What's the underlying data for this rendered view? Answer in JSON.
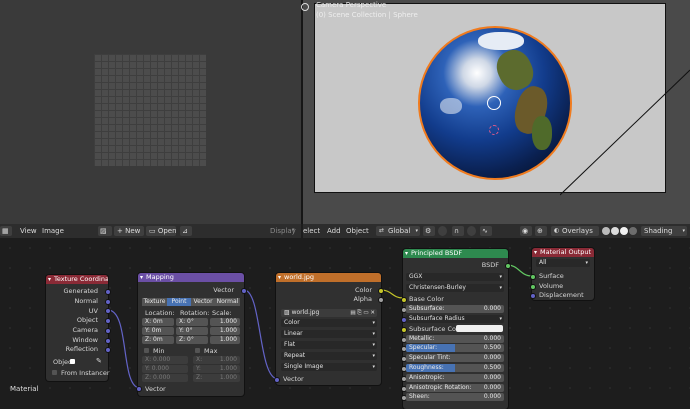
{
  "viewport": {
    "title": "Camera Perspective",
    "subtitle": "(0) Scene Collection | Sphere",
    "header": {
      "menu_select": "elect",
      "menu_add": "Add",
      "menu_object": "Object",
      "transform_orientation": "Global",
      "overlays": "Overlays",
      "shading": "Shading"
    }
  },
  "image_editor": {
    "header": {
      "view": "View",
      "image": "Image",
      "new": "New",
      "open": "Open",
      "display": "Display"
    }
  },
  "node_editor": {
    "material_label": "Material",
    "tex_coord": {
      "title": "Texture Coordina.",
      "outputs": [
        "Generated",
        "Normal",
        "UV",
        "Object",
        "Camera",
        "Window",
        "Reflection"
      ],
      "object_label": "Objec",
      "from_instancer": "From Instancer"
    },
    "mapping": {
      "title": "Mapping",
      "output": "Vector",
      "tabs": [
        "Texture",
        "Point",
        "Vector",
        "Normal"
      ],
      "active_tab": "Point",
      "location_label": "Location:",
      "rotation_label": "Rotation:",
      "scale_label": "Scale:",
      "location": [
        "X: 0m",
        "Y: 0m",
        "Z: 0m"
      ],
      "rotation": [
        "X:  0°",
        "Y:  0°",
        "Z:  0°"
      ],
      "scale": [
        "1.000",
        "1.000",
        "1.000"
      ],
      "min_label": "Min",
      "max_label": "Max",
      "min": [
        "X:   0.000",
        "Y:   0.000",
        "Z:   0.000"
      ],
      "max": [
        "1.000",
        "1.000",
        "1.000"
      ],
      "max_axes": [
        "X:",
        "Y:",
        "Z:"
      ],
      "input": "Vector"
    },
    "image_tex": {
      "title": "world.jpg",
      "outputs": [
        "Color",
        "Alpha"
      ],
      "image_name": "world.jpg",
      "dropdowns": [
        "Color",
        "Linear",
        "Flat",
        "Repeat",
        "Single Image"
      ],
      "input": "Vector"
    },
    "bsdf": {
      "title": "Principled BSDF",
      "output": "BSDF",
      "distribution": "GGX",
      "subsurface_method": "Christensen-Burley",
      "base_color": "Base Color",
      "subsurface": {
        "label": "Subsurface:",
        "value": "0.000"
      },
      "subsurface_radius": "Subsurface Radius",
      "subsurface_color": "Subsurface Colo",
      "metallic": {
        "label": "Metallic:",
        "value": "0.000"
      },
      "specular": {
        "label": "Specular:",
        "value": "0.500",
        "fill": 0.5
      },
      "specular_tint": {
        "label": "Specular Tint:",
        "value": "0.000"
      },
      "roughness": {
        "label": "Roughness:",
        "value": "0.500",
        "fill": 0.5
      },
      "anisotropic": {
        "label": "Anisotropic:",
        "value": "0.000"
      },
      "anisotropic_rotation": {
        "label": "Anisotropic Rotation:",
        "value": "0.000"
      },
      "sheen": {
        "label": "Sheen:",
        "value": "0.000"
      }
    },
    "output": {
      "title": "Material Output",
      "target": "All",
      "inputs": [
        "Surface",
        "Volume",
        "Displacement"
      ]
    }
  },
  "colors": {
    "texcoord_header": "#8a2a36",
    "mapping_header": "#6b4fa5",
    "image_header": "#c06f2a",
    "bsdf_header": "#2e8a4f",
    "output_header": "#8a2a36",
    "socket_vector": "#6363c7",
    "socket_color": "#c7c729",
    "socket_float": "#a1a1a1",
    "socket_shader": "#63c763",
    "accent": "#4772b3",
    "selection": "#f07b1e"
  }
}
